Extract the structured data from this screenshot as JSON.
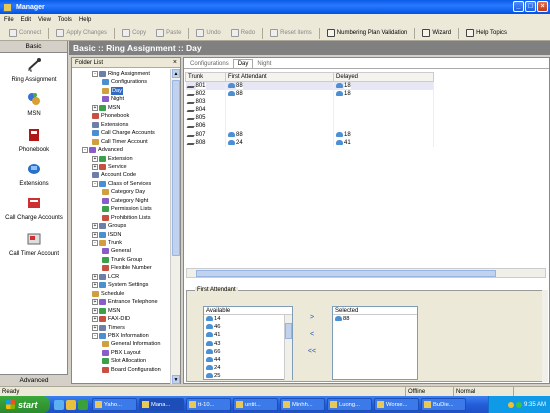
{
  "window": {
    "title": "Manager"
  },
  "menu": [
    "File",
    "Edit",
    "View",
    "Tools",
    "Help"
  ],
  "toolbar": [
    {
      "label": "Connect",
      "enabled": false
    },
    {
      "label": "Apply Changes",
      "enabled": false
    },
    {
      "label": "Copy",
      "enabled": false
    },
    {
      "label": "Paste",
      "enabled": false
    },
    {
      "label": "Undo",
      "enabled": false
    },
    {
      "label": "Redo",
      "enabled": false
    },
    {
      "label": "Reset items",
      "enabled": false
    },
    {
      "label": "Numbering Plan Validation",
      "enabled": true
    },
    {
      "label": "Wizard",
      "enabled": true
    },
    {
      "label": "Help Topics",
      "enabled": true
    }
  ],
  "leftnav": {
    "header": "Basic",
    "footer": "Advanced",
    "items": [
      "Ring Assignment",
      "MSN",
      "Phonebook",
      "Extensions",
      "Call Charge Accounts",
      "Call Timer Account"
    ]
  },
  "header": "Basic :: Ring Assignment :: Day",
  "folder": {
    "title": "Folder List",
    "close": "×",
    "nodes": [
      {
        "label": "Ring Assignment",
        "level": 2,
        "exp": "-"
      },
      {
        "label": "Configurations",
        "level": 3
      },
      {
        "label": "Day",
        "level": 3,
        "selected": true
      },
      {
        "label": "Night",
        "level": 3
      },
      {
        "label": "MSN",
        "level": 2,
        "exp": "+"
      },
      {
        "label": "Phonebook",
        "level": 2
      },
      {
        "label": "Extensions",
        "level": 2
      },
      {
        "label": "Call Charge Accounts",
        "level": 2
      },
      {
        "label": "Call Timer Account",
        "level": 2
      },
      {
        "label": "Advanced",
        "level": 1,
        "exp": "-"
      },
      {
        "label": "Extension",
        "level": 2,
        "exp": "+"
      },
      {
        "label": "Service",
        "level": 2,
        "exp": "+"
      },
      {
        "label": "Account Code",
        "level": 2
      },
      {
        "label": "Class of Services",
        "level": 2,
        "exp": "-"
      },
      {
        "label": "Category Day",
        "level": 3
      },
      {
        "label": "Category Night",
        "level": 3
      },
      {
        "label": "Permission Lists",
        "level": 3
      },
      {
        "label": "Prohibition Lists",
        "level": 3
      },
      {
        "label": "Groups",
        "level": 2,
        "exp": "+"
      },
      {
        "label": "ISDN",
        "level": 2,
        "exp": "+"
      },
      {
        "label": "Trunk",
        "level": 2,
        "exp": "-"
      },
      {
        "label": "General",
        "level": 3
      },
      {
        "label": "Trunk Group",
        "level": 3
      },
      {
        "label": "Flexible Number",
        "level": 3
      },
      {
        "label": "LCR",
        "level": 2,
        "exp": "+"
      },
      {
        "label": "System Settings",
        "level": 2,
        "exp": "+"
      },
      {
        "label": "Schedule",
        "level": 2
      },
      {
        "label": "Entrance Telephone",
        "level": 2,
        "exp": "+"
      },
      {
        "label": "MSN",
        "level": 2,
        "exp": "+"
      },
      {
        "label": "FAX-DID",
        "level": 2,
        "exp": "+"
      },
      {
        "label": "Timers",
        "level": 2,
        "exp": "+"
      },
      {
        "label": "PBX Information",
        "level": 2,
        "exp": "-"
      },
      {
        "label": "General Information",
        "level": 3
      },
      {
        "label": "PBX Layout",
        "level": 3
      },
      {
        "label": "Slot Allocation",
        "level": 3
      },
      {
        "label": "Board Configuration",
        "level": 3
      }
    ]
  },
  "tabs": [
    "Configurations",
    "Day",
    "Night"
  ],
  "table": {
    "headers": [
      "Trunk",
      "First Attendant",
      "Delayed"
    ],
    "rows": [
      [
        "801",
        "88",
        "18"
      ],
      [
        "802",
        "88",
        "18"
      ],
      [
        "803",
        "",
        ""
      ],
      [
        "804",
        "",
        ""
      ],
      [
        "805",
        "",
        ""
      ],
      [
        "806",
        "",
        ""
      ],
      [
        "807",
        "88",
        "18"
      ],
      [
        "808",
        "24",
        "41"
      ]
    ]
  },
  "firstAttendant": {
    "label": "First Attendant",
    "availableLabel": "Available",
    "available": [
      "14",
      "46",
      "41",
      "43",
      "66",
      "44",
      "24",
      "25"
    ],
    "selectedLabel": "Selected",
    "selected": [
      "88"
    ],
    "buttons": [
      ">",
      "<",
      "<<"
    ]
  },
  "status": {
    "left": "Ready",
    "offline": "Offline",
    "normal": "Normal"
  },
  "taskbar": {
    "start": "start",
    "tasks": [
      "Yaho...",
      "Mana...",
      "tt-10...",
      "untit...",
      "Minhh...",
      "Luong...",
      "Worse...",
      "BuDie..."
    ],
    "clock": "9:35 AM"
  }
}
